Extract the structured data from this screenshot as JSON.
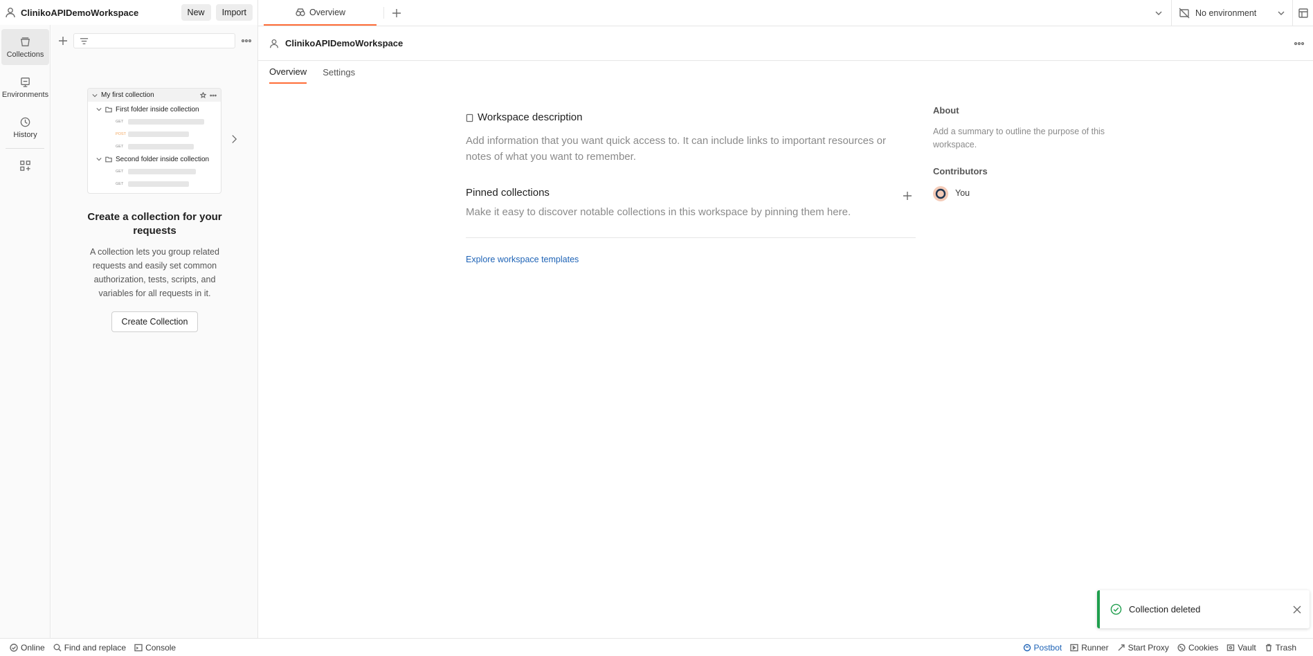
{
  "workspace": {
    "name": "ClinikoAPIDemoWorkspace"
  },
  "top_buttons": {
    "new_label": "New",
    "import_label": "Import"
  },
  "tabs": [
    {
      "label": "Overview"
    }
  ],
  "environment": {
    "selected": "No environment"
  },
  "rail": [
    {
      "label": "Collections",
      "icon": "collections-icon",
      "active": true
    },
    {
      "label": "Environments",
      "icon": "environments-icon",
      "active": false
    },
    {
      "label": "History",
      "icon": "history-icon",
      "active": false
    }
  ],
  "preview": {
    "collection": "My first collection",
    "folder1": "First folder inside collection",
    "folder2": "Second folder inside collection",
    "methods": [
      "GET",
      "POST",
      "GET",
      "GET",
      "GET"
    ]
  },
  "empty_state": {
    "title": "Create a collection for your requests",
    "description": "A collection lets you group related requests and easily set common authorization, tests, scripts, and variables for all requests in it.",
    "button": "Create Collection"
  },
  "main": {
    "title": "ClinikoAPIDemoWorkspace",
    "tabs": [
      {
        "label": "Overview",
        "active": true
      },
      {
        "label": "Settings",
        "active": false
      }
    ],
    "description_heading": "Workspace description",
    "description_placeholder": "Add information that you want quick access to. It can include links to important resources or notes of what you want to remember.",
    "pinned_heading": "Pinned collections",
    "pinned_placeholder": "Make it easy to discover notable collections in this workspace by pinning them here.",
    "templates_link": "Explore workspace templates"
  },
  "about": {
    "heading": "About",
    "summary": "Add a summary to outline the purpose of this workspace.",
    "contributors_heading": "Contributors",
    "contributor": "You"
  },
  "toast": {
    "message": "Collection deleted"
  },
  "statusbar": {
    "left": [
      "Online",
      "Find and replace",
      "Console"
    ],
    "right": [
      "Postbot",
      "Runner",
      "Start Proxy",
      "Cookies",
      "Vault",
      "Trash"
    ]
  },
  "colors": {
    "accent": "#ff6c37",
    "link": "#1e63b6",
    "success": "#1f9e4d"
  }
}
